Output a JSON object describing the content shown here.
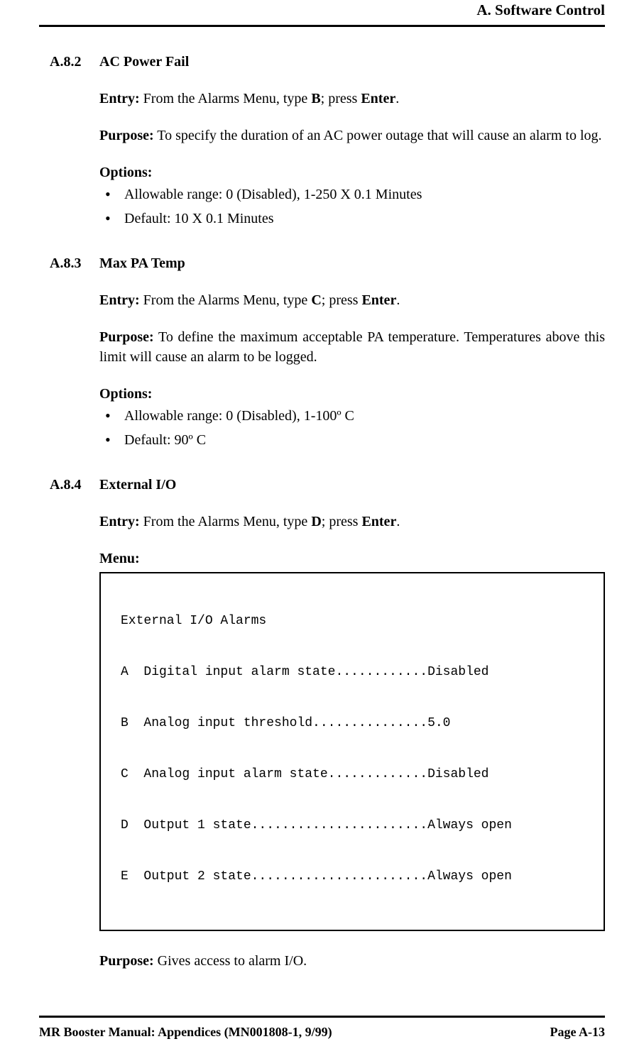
{
  "header": {
    "title": "A. Software Control"
  },
  "sections": [
    {
      "number": "A.8.2",
      "title": "AC Power Fail",
      "entry_label": "Entry:",
      "entry_text_1": " From the Alarms Menu, type ",
      "entry_key": "B",
      "entry_text_2": "; press ",
      "entry_action": "Enter",
      "entry_text_3": ".",
      "purpose_label": "Purpose:",
      "purpose_text": " To specify the duration of an AC power outage that will cause an alarm to log.",
      "options_label": "Options:",
      "options": [
        "Allowable range: 0 (Disabled), 1-250 X 0.1 Minutes",
        "Default: 10 X 0.1 Minutes"
      ]
    },
    {
      "number": "A.8.3",
      "title": "Max PA Temp",
      "entry_label": "Entry:",
      "entry_text_1": " From the Alarms Menu, type ",
      "entry_key": "C",
      "entry_text_2": "; press ",
      "entry_action": "Enter",
      "entry_text_3": ".",
      "purpose_label": "Purpose:",
      "purpose_text": " To define the maximum acceptable PA temperature. Temperatures above this limit will cause an alarm to be logged.",
      "options_label": "Options:",
      "options": [
        "Allowable range: 0 (Disabled), 1-100º C",
        "Default: 90º C"
      ]
    },
    {
      "number": "A.8.4",
      "title": "External I/O",
      "entry_label": "Entry:",
      "entry_text_1": " From the Alarms Menu, type ",
      "entry_key": "D",
      "entry_text_2": "; press ",
      "entry_action": "Enter",
      "entry_text_3": ".",
      "menu_label": "Menu:",
      "menu": {
        "title": "External I/O Alarms",
        "items": [
          "A  Digital input alarm state............Disabled",
          "B  Analog input threshold...............5.0",
          "C  Analog input alarm state.............Disabled",
          "D  Output 1 state.......................Always open",
          "E  Output 2 state.......................Always open"
        ]
      },
      "purpose_label": "Purpose:",
      "purpose_text": " Gives access to alarm I/O."
    }
  ],
  "footer": {
    "left": "MR Booster Manual: Appendices (MN001808-1, 9/99)",
    "right": "Page A-13"
  }
}
